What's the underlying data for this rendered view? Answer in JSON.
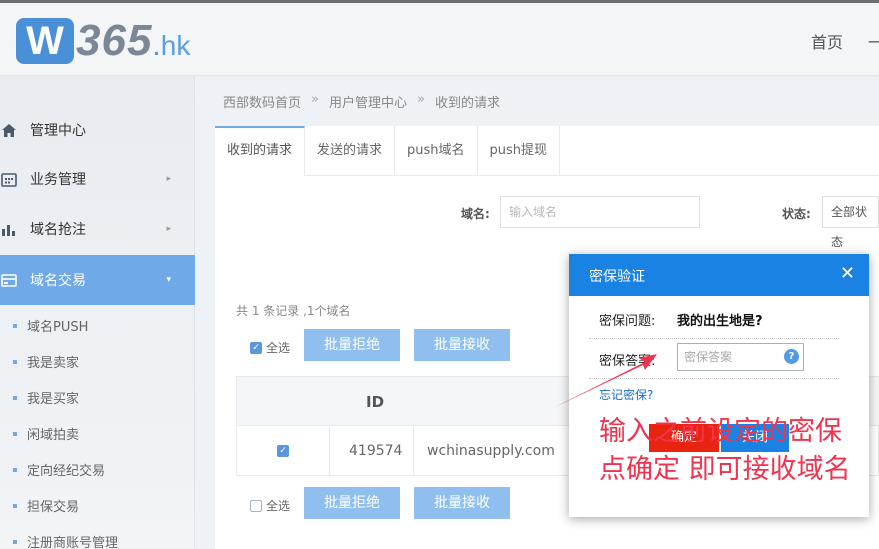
{
  "header": {
    "logo_text": "W365.hk",
    "logo_mark": "W",
    "logo_number": "365",
    "logo_dot": ".",
    "logo_tld": "hk",
    "nav_home": "首页",
    "nav_more": "一"
  },
  "sidebar": {
    "items": [
      {
        "label": "管理中心",
        "icon": "home-icon"
      },
      {
        "label": "业务管理",
        "icon": "grid-icon",
        "arrow": "▸"
      },
      {
        "label": "域名抢注",
        "icon": "bar-chart-icon",
        "arrow": "▸"
      },
      {
        "label": "域名交易",
        "icon": "card-icon",
        "arrow": "▾"
      }
    ],
    "sub_items": [
      {
        "label": "域名PUSH"
      },
      {
        "label": "我是卖家"
      },
      {
        "label": "我是买家"
      },
      {
        "label": "闲域拍卖"
      },
      {
        "label": "定向经纪交易"
      },
      {
        "label": "担保交易"
      },
      {
        "label": "注册商账号管理"
      }
    ],
    "accent_color": "#6fa9e8"
  },
  "breadcrumb": {
    "items": [
      "西部数码首页",
      "用户管理中心",
      "收到的请求"
    ],
    "sep": "»"
  },
  "tabs": [
    {
      "label": "收到的请求",
      "active": true
    },
    {
      "label": "发送的请求"
    },
    {
      "label": "push域名"
    },
    {
      "label": "push提现"
    }
  ],
  "filters": {
    "domain_label": "域名:",
    "domain_placeholder": "输入域名",
    "status_label": "状态:",
    "status_value": "全部状态"
  },
  "summary": "共 1 条记录 ,1个域名",
  "bulk": {
    "select_all": "全选",
    "reject": "批量拒绝",
    "accept": "批量接收"
  },
  "table": {
    "columns": [
      "ID"
    ],
    "rows": [
      {
        "id": "419574",
        "domain": "wchinasupply.com",
        "checked": true
      }
    ]
  },
  "modal": {
    "title": "密保验证",
    "question_label": "密保问题:",
    "question": "我的出生地是?",
    "answer_label": "密保答案:",
    "answer_placeholder": "密保答案",
    "help": "?",
    "forgot": "忘记密保?",
    "ok": "确定",
    "cancel": "关闭",
    "close": "✕",
    "header_color": "#1a82e2",
    "ok_color": "#e8230f"
  },
  "annotation": {
    "line1": "输入之前设定的密保",
    "line2": "点确定 即可接收域名",
    "color": "#f0334f"
  }
}
